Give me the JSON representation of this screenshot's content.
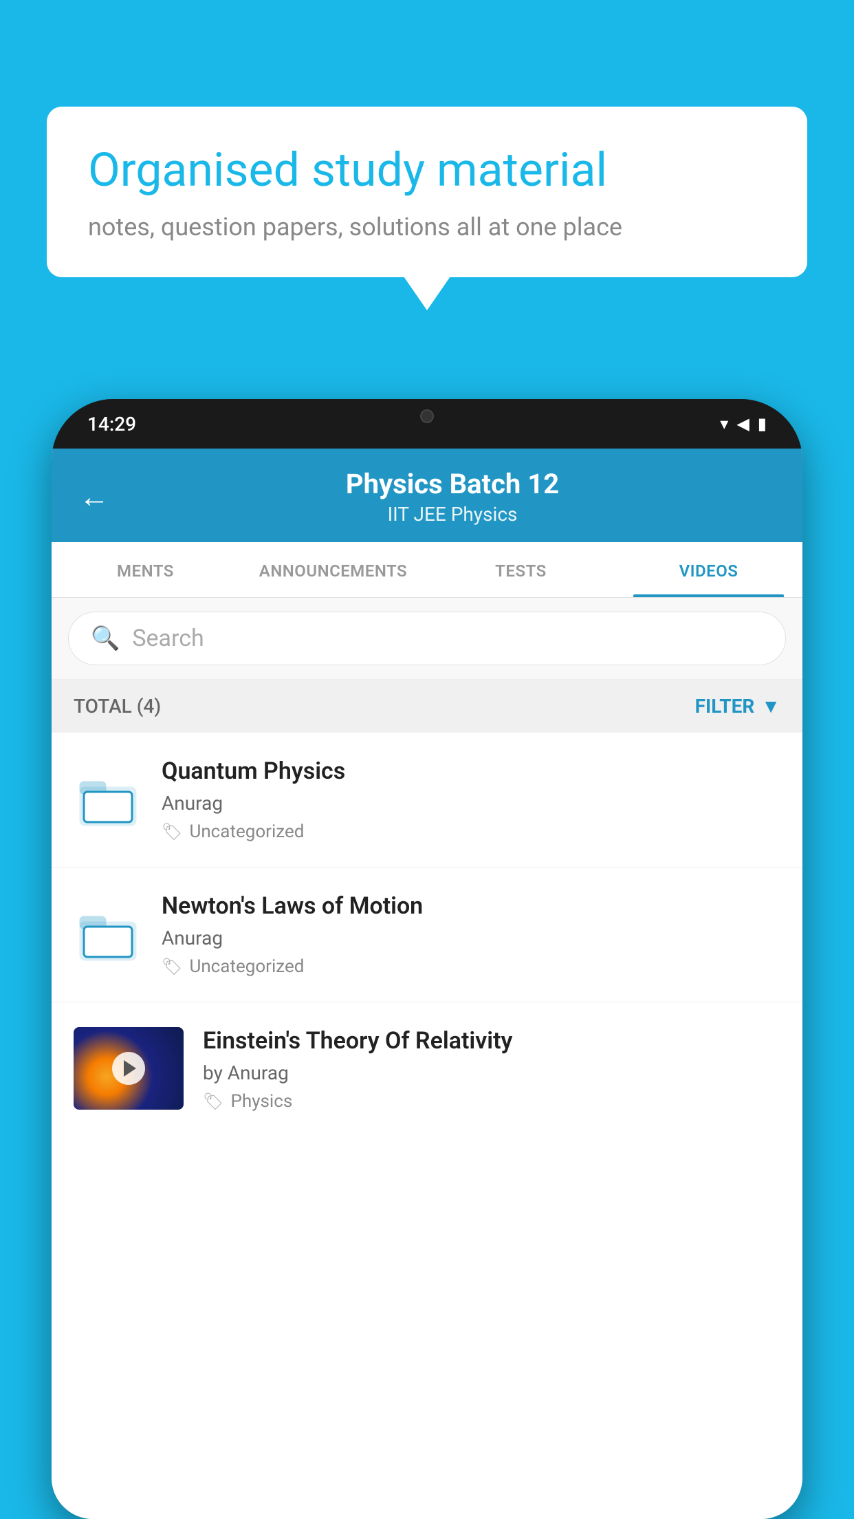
{
  "background_color": "#1ab8e8",
  "speech_bubble": {
    "title": "Organised study material",
    "subtitle": "notes, question papers, solutions all at one place"
  },
  "phone": {
    "time": "14:29",
    "app": {
      "header": {
        "title": "Physics Batch 12",
        "subtitle": "IIT JEE   Physics",
        "back_label": "←"
      },
      "tabs": [
        {
          "label": "MENTS",
          "active": false
        },
        {
          "label": "ANNOUNCEMENTS",
          "active": false
        },
        {
          "label": "TESTS",
          "active": false
        },
        {
          "label": "VIDEOS",
          "active": true
        }
      ],
      "search": {
        "placeholder": "Search"
      },
      "filter_bar": {
        "total_label": "TOTAL (4)",
        "filter_label": "FILTER"
      },
      "videos": [
        {
          "id": 1,
          "title": "Quantum Physics",
          "author": "Anurag",
          "tag": "Uncategorized",
          "type": "folder",
          "has_thumb": false
        },
        {
          "id": 2,
          "title": "Newton's Laws of Motion",
          "author": "Anurag",
          "tag": "Uncategorized",
          "type": "folder",
          "has_thumb": false
        },
        {
          "id": 3,
          "title": "Einstein's Theory Of Relativity",
          "author": "by Anurag",
          "tag": "Physics",
          "type": "video",
          "has_thumb": true
        }
      ]
    }
  }
}
